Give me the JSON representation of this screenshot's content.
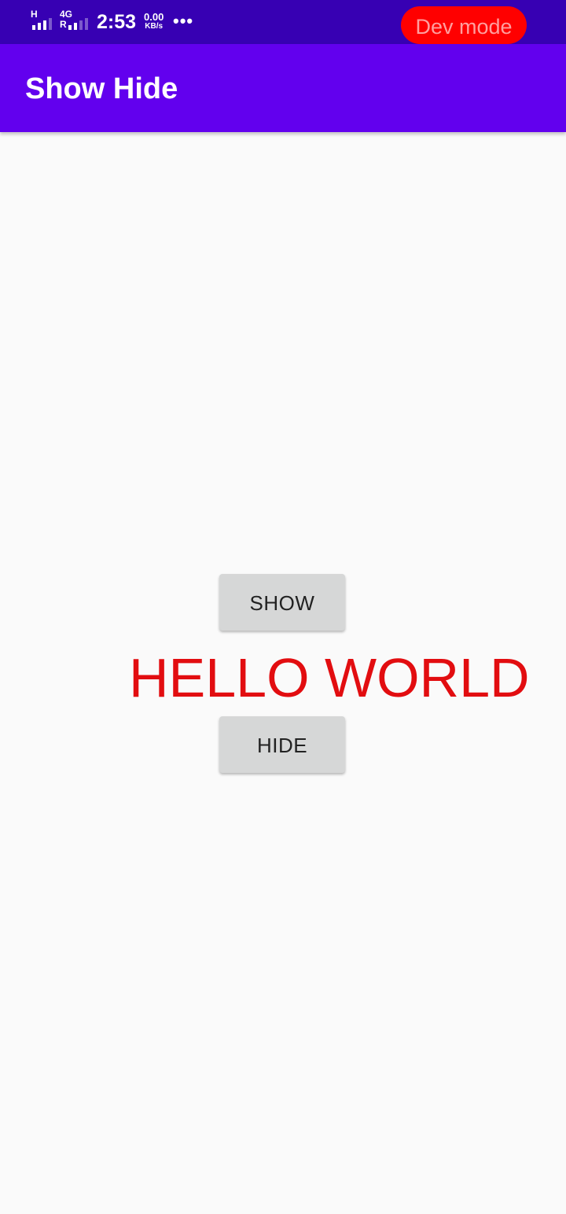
{
  "status_bar": {
    "sim1_network": "H",
    "sim2_network": "4G",
    "sim2_sub": "R",
    "time": "2:53",
    "speed_value": "0.00",
    "speed_unit": "KB/s",
    "more_dots": "•••",
    "dev_mode_label": "Dev mode",
    "colors": {
      "background": "#3700b3",
      "dev_pill": "#ff0000"
    }
  },
  "app_bar": {
    "title": "Show Hide",
    "background": "#6200ee"
  },
  "main": {
    "show_button_label": "SHOW",
    "hello_text": "HELLO WORLD",
    "hide_button_label": "HIDE",
    "hello_color": "#e20d10"
  }
}
